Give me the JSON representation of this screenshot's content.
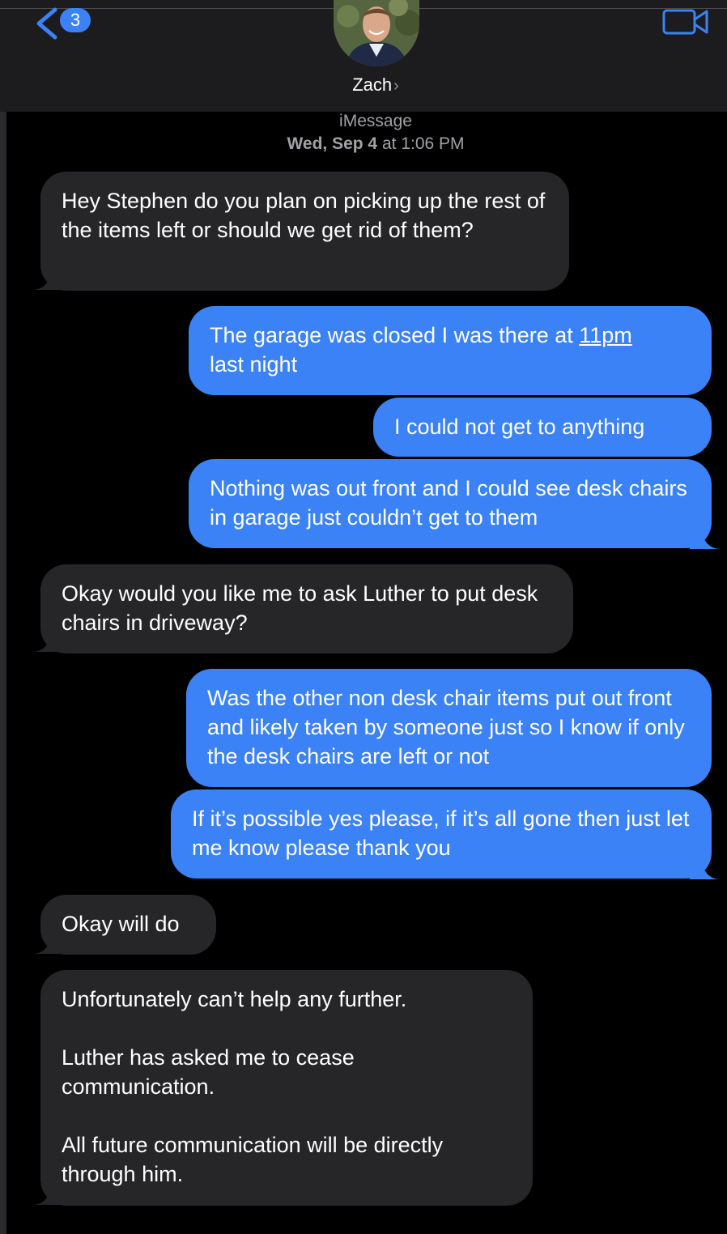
{
  "nav": {
    "unread_count": "3"
  },
  "contact": {
    "name": "Zach",
    "chevron": "›"
  },
  "thread": {
    "service": "iMessage",
    "date_day": "Wed, Sep 4",
    "date_at": "at 1:06 PM"
  },
  "messages": [
    {
      "direction": "incoming",
      "text": "Hey Stephen do you plan on picking up the rest of the items left or should we get rid of them?"
    },
    {
      "direction": "outgoing",
      "text_before": "The garage was closed I was there at ",
      "link": "11pm",
      "text_after": "\nlast night"
    },
    {
      "direction": "outgoing",
      "text": "I could not get to anything"
    },
    {
      "direction": "outgoing",
      "text": "Nothing was out front and I could see desk chairs in garage just couldn’t get to them"
    },
    {
      "direction": "incoming",
      "text": "Okay would you like me to ask Luther to put desk chairs in driveway?"
    },
    {
      "direction": "outgoing",
      "text": "Was the other non desk chair items put out front and likely taken by someone just so I know if only the desk chairs are left or not"
    },
    {
      "direction": "outgoing",
      "text": "If it’s possible yes please, if it’s all gone then just let me know please thank you"
    },
    {
      "direction": "incoming",
      "text": "Okay will do"
    },
    {
      "direction": "incoming",
      "text": "Unfortunately can’t help any further.\n\nLuther has asked me to cease communication.\n\nAll future communication will be directly through him."
    }
  ],
  "colors": {
    "outgoing_bubble": "#3a82f6",
    "incoming_bubble": "#262629",
    "accent": "#3b82f6"
  },
  "icons": [
    "back-chevron-icon",
    "video-camera-icon",
    "chevron-right-icon"
  ]
}
